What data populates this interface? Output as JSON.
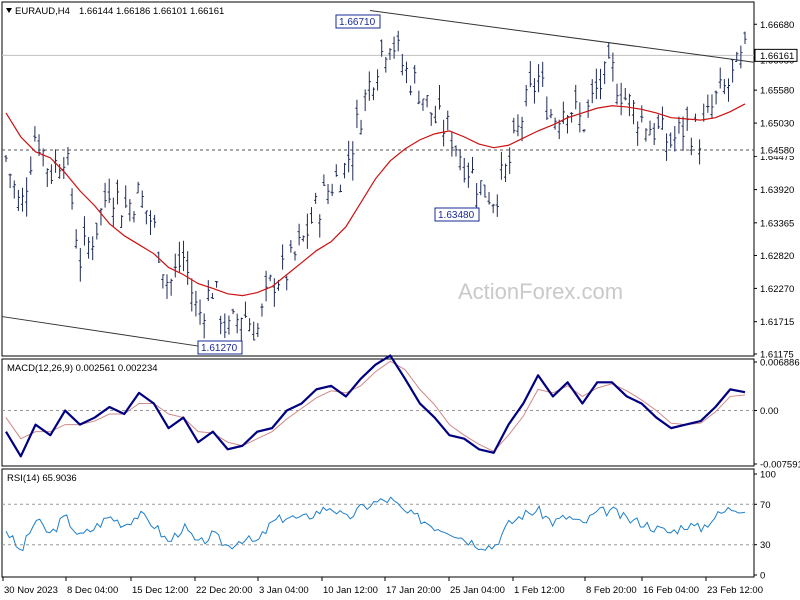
{
  "header": {
    "symbol": "EURAUD,H4",
    "ohlc": "1.66144 1.66186 1.66101 1.66161"
  },
  "watermark": "ActionForex.com",
  "colors": {
    "candle": "#1e2a57",
    "sma": "#cc1111",
    "macd": "#000080",
    "signal": "#d08a8a",
    "rsi": "#1e7fc8",
    "trendline": "#333333",
    "price_line": "#c0c0c0",
    "label_box": "#1a2a9a"
  },
  "chart_data": [
    {
      "type": "line",
      "title": "EURAUD,H4",
      "subtitle": "1.66144 1.66186 1.66101 1.66161",
      "x": [
        "30 Nov 2023",
        "8 Dec 04:00",
        "15 Dec 12:00",
        "22 Dec 20:00",
        "3 Jan 04:00",
        "10 Jan 12:00",
        "17 Jan 20:00",
        "25 Jan 04:00",
        "1 Feb 12:00",
        "8 Feb 20:00",
        "16 Feb 04:00",
        "23 Feb 12:00"
      ],
      "ylim": [
        1.61175,
        1.66985
      ],
      "y_ticks": [
        "1.66680",
        "1.66080",
        "1.65580",
        "1.65030",
        "1.64475",
        "1.63920",
        "1.63365",
        "1.62820",
        "1.62270",
        "1.61715",
        "1.61175"
      ],
      "series": [
        {
          "values": [
            1.6445,
            1.6355,
            1.649,
            1.642,
            1.646,
            1.6275,
            1.632,
            1.64,
            1.636,
            1.6385,
            1.633,
            1.623,
            1.628,
            1.618,
            1.623,
            1.615,
            1.619,
            1.6155,
            1.624,
            1.6255,
            1.63,
            1.636,
            1.64,
            1.643,
            1.652,
            1.66,
            1.665,
            1.659,
            1.656,
            1.651,
            1.649,
            1.644,
            1.64,
            1.638,
            1.643,
            1.652,
            1.658,
            1.651,
            1.654,
            1.65,
            1.656,
            1.659,
            1.654,
            1.651,
            1.649,
            1.647,
            1.65,
            1.648,
            1.654,
            1.657,
            1.6616
          ]
        },
        {
          "values": [
            1.652,
            1.648,
            1.6455,
            1.6445,
            1.642,
            1.639,
            1.6365,
            1.6335,
            1.6315,
            1.63,
            1.6285,
            1.6262,
            1.625,
            1.6235,
            1.6227,
            1.6218,
            1.6215,
            1.622,
            1.623,
            1.625,
            1.627,
            1.629,
            1.6305,
            1.633,
            1.637,
            1.641,
            1.644,
            1.646,
            1.6475,
            1.6485,
            1.649,
            1.648,
            1.6468,
            1.6462,
            1.6466,
            1.6478,
            1.649,
            1.65,
            1.6512,
            1.652,
            1.6528,
            1.6532,
            1.653,
            1.6526,
            1.652,
            1.6512,
            1.651,
            1.6508,
            1.6512,
            1.6522,
            1.6535
          ]
        }
      ],
      "annotations": [
        {
          "text": "1.66710",
          "x": "17 Jan 20:00",
          "y": 1.6671
        },
        {
          "text": "1.63480",
          "x": "25 Jan 04:00",
          "y": 1.6348
        },
        {
          "text": "1.61270",
          "x": "22 Dec 20:00",
          "y": 1.6127
        }
      ],
      "hlines": [
        {
          "label": "1.66161",
          "value": 1.66161,
          "style": "solid"
        },
        {
          "label": "1.64580",
          "value": 1.6458,
          "style": "dashed"
        }
      ],
      "watermark": "ActionForex.com"
    },
    {
      "type": "line",
      "title": "MACD(12,26,9) 0.002561 0.002234",
      "ylim": [
        -0.007591,
        0.006886
      ],
      "y_ticks": [
        "0.006886",
        "0.00",
        "-0.007591"
      ],
      "series": [
        {
          "values": [
            -0.003,
            -0.0065,
            -0.002,
            -0.0035,
            0.0,
            -0.002,
            -0.001,
            0.0005,
            -0.0005,
            0.0025,
            0.001,
            -0.0025,
            -0.001,
            -0.0045,
            -0.003,
            -0.0055,
            -0.005,
            -0.003,
            -0.0025,
            0.0,
            0.001,
            0.003,
            0.0035,
            0.002,
            0.0045,
            0.0065,
            0.0078,
            0.0045,
            0.001,
            -0.001,
            -0.0035,
            -0.004,
            -0.0055,
            -0.006,
            -0.002,
            0.001,
            0.005,
            0.002,
            0.004,
            0.001,
            0.004,
            0.004,
            0.002,
            0.001,
            -0.001,
            -0.0025,
            -0.002,
            -0.0015,
            0.0005,
            0.003,
            0.0026
          ]
        },
        {
          "values": [
            -0.001,
            -0.004,
            -0.003,
            -0.003,
            -0.002,
            -0.002,
            -0.0015,
            -0.0005,
            -0.0005,
            0.001,
            0.001,
            -0.0005,
            -0.001,
            -0.003,
            -0.0032,
            -0.0045,
            -0.005,
            -0.004,
            -0.003,
            -0.0012,
            0.0003,
            0.0018,
            0.0028,
            0.0025,
            0.0035,
            0.0055,
            0.007,
            0.0058,
            0.003,
            0.0008,
            -0.002,
            -0.0035,
            -0.0048,
            -0.0058,
            -0.0035,
            -0.0008,
            0.003,
            0.0025,
            0.0035,
            0.002,
            0.0032,
            0.0038,
            0.0028,
            0.0015,
            0.0,
            -0.0018,
            -0.002,
            -0.0018,
            -0.0002,
            0.002,
            0.0022
          ]
        }
      ]
    },
    {
      "type": "line",
      "title": "RSI(14) 65.9036",
      "ylim": [
        0,
        100
      ],
      "y_ticks": [
        "100",
        "70",
        "30",
        "0"
      ],
      "series": [
        {
          "values": [
            45,
            22,
            55,
            40,
            58,
            38,
            47,
            58,
            50,
            60,
            50,
            32,
            48,
            30,
            40,
            28,
            36,
            32,
            52,
            58,
            55,
            62,
            68,
            55,
            66,
            72,
            75,
            62,
            56,
            48,
            44,
            36,
            30,
            28,
            50,
            60,
            64,
            52,
            58,
            50,
            62,
            64,
            55,
            52,
            46,
            42,
            50,
            46,
            58,
            66,
            66
          ]
        }
      ]
    }
  ],
  "xaxis_labels": [
    "30 Nov 2023",
    "8 Dec 04:00",
    "15 Dec 12:00",
    "22 Dec 20:00",
    "3 Jan 04:00",
    "10 Jan 12:00",
    "17 Jan 20:00",
    "25 Jan 04:00",
    "1 Feb 12:00",
    "8 Feb 20:00",
    "16 Feb 04:00",
    "23 Feb 12:00"
  ]
}
